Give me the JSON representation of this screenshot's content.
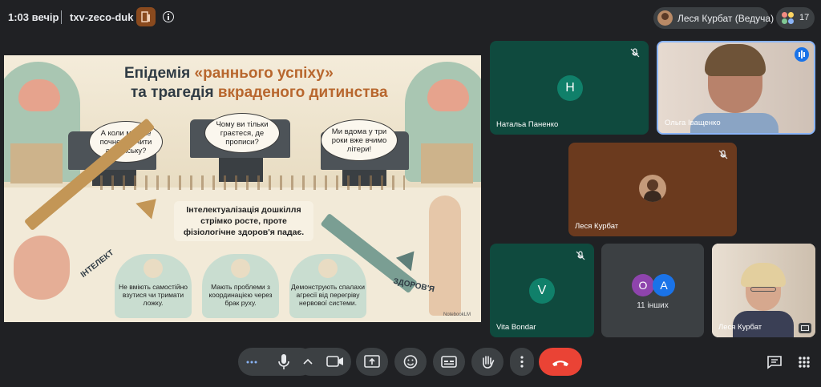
{
  "topbar": {
    "time": "1:03 вечір",
    "meeting_code": "txv-zeco-duk",
    "host_label": "Леся Курбат (Ведуча)",
    "participant_count": "17"
  },
  "slide": {
    "title_line1_a": "Епідемія ",
    "title_line1_b": "«раннього успіху»",
    "title_line2_a": "та трагедія ",
    "title_line2_b": "вкраденого дитинства",
    "bubble1": "А коли ми вже почнемо вчити англійську?",
    "bubble2": "Чому ви тільки граєтеся, де прописи?",
    "bubble3": "Ми вдома у три роки вже вчимо літери!",
    "center_message": "Інтелектуалізація дошкілля стрімко росте, проте фізіологічне здоров'я падає.",
    "intellect_label": "ІНТЕЛЕКТ",
    "health_label": "ЗДОРОВ'Я",
    "card1": "Не вміють самостійно взутися чи тримати ложку.",
    "card2": "Мають проблеми з координацією через брак руху.",
    "card3": "Демонструють спалахи агресії від перегріву нервової системи.",
    "watermark": "NotebookLM"
  },
  "tiles": {
    "t1": {
      "name": "Натальа Паненко",
      "initial": "Н"
    },
    "t2": {
      "name": "Ольга Іващенко"
    },
    "t3": {
      "name": "Леся Курбат"
    },
    "t4": {
      "name": "Vita Bondar",
      "initial": "V"
    },
    "t5": {
      "label": "11 інших",
      "a1": "O",
      "a2": "A"
    },
    "t6": {
      "name": "Леся Курбат"
    }
  },
  "colors": {
    "end_call": "#ea4335",
    "tile_green": "#0f4a3e",
    "tile_brown": "#6b3a1e",
    "control_bg": "#3c4043"
  }
}
